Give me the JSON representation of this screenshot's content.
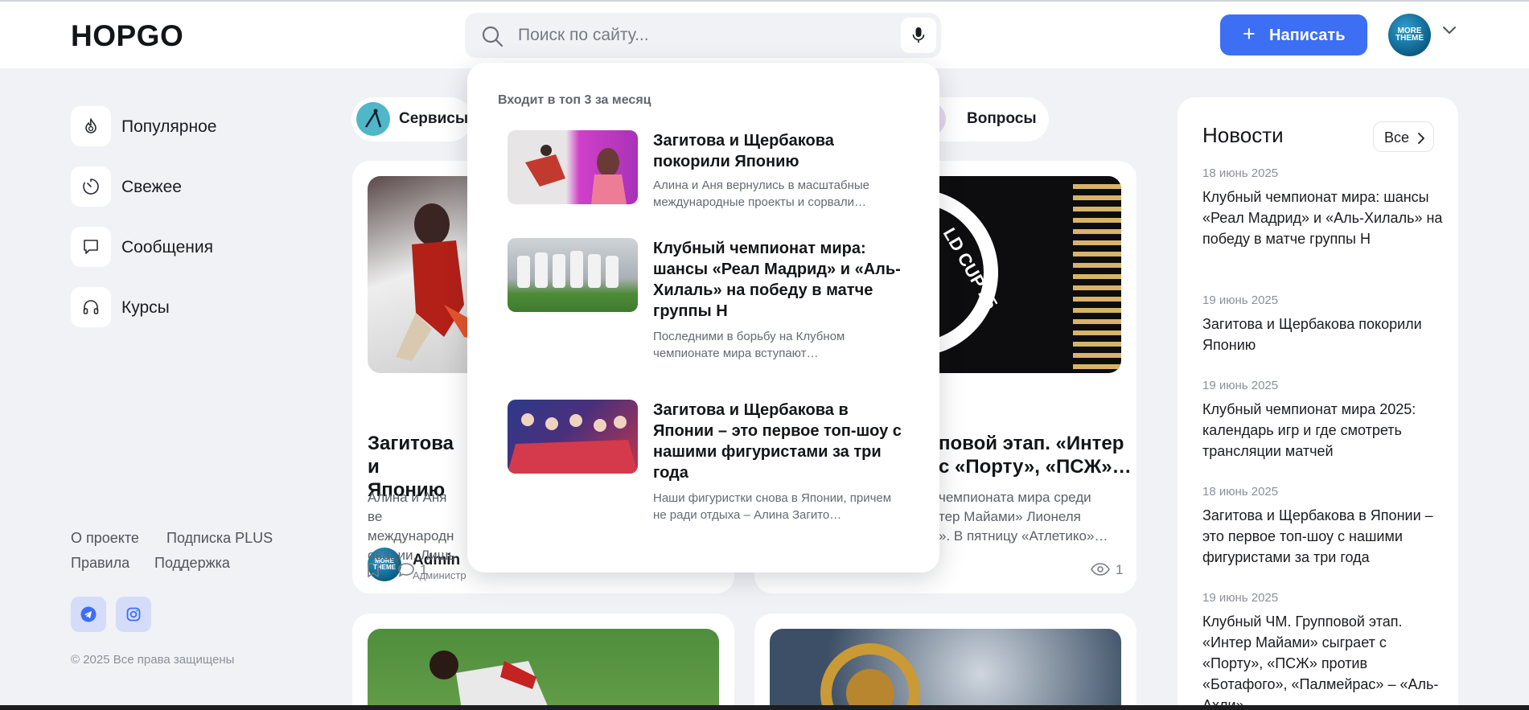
{
  "header": {
    "logo": "HOPGO",
    "search_placeholder": "Поиск по сайту...",
    "write_label": "Написать",
    "write_plus": "+",
    "avatar_text": "MORE THEME"
  },
  "sidebar": {
    "items": [
      {
        "label": "Популярное",
        "icon": "flame-icon"
      },
      {
        "label": "Свежее",
        "icon": "timer-icon"
      },
      {
        "label": "Сообщения",
        "icon": "message-icon"
      },
      {
        "label": "Курсы",
        "icon": "headphones-icon"
      }
    ],
    "footer_links": [
      "О проекте",
      "Подписка PLUS",
      "Правила",
      "Поддержка"
    ],
    "social": [
      "telegram-icon",
      "instagram-icon"
    ],
    "copyright": "© 2025 Все права защищены"
  },
  "chips": [
    {
      "label": "Сервисы"
    },
    {
      "label": "Вопросы"
    }
  ],
  "cards": [
    {
      "author": "Admin",
      "role": "Администр",
      "avatar_text": "MORE THEME",
      "title": "Загитова и Щербакова покорили Японию",
      "title_visible": "Загитова и\nЯпонию",
      "excerpt": "Алина и Аня вернулись в масштабные международные проекты и сорвали овации. Лишь",
      "excerpt_visible": "Алина и Аня ве\nмеждународн\nовации. Лишь",
      "comments": "1"
    },
    {
      "title_visible": "повой этап. «Интер\nс «Порту», «ПСЖ»…",
      "excerpt_visible": "чемпионата мира среди\nтер Майами» Лионеля\n». В пятницу «Атлетико»…",
      "views": "1"
    }
  ],
  "dropdown": {
    "heading": "Входит в топ 3 за месяц",
    "items": [
      {
        "title": "Загитова и Щербакова покорили Японию",
        "excerpt": "Алина и Аня вернулись в масштабные международные проекты и сорвали…"
      },
      {
        "title": "Клубный чемпионат мира: шансы «Реал Мадрид» и «Аль-Хилаль» на победу в матче группы H",
        "excerpt": "Последними в борьбу на Клубном чемпионате мира вступают…"
      },
      {
        "title": "Загитова и Щербакова в Японии – это первое топ-шоу с нашими фигуристами за три года",
        "excerpt": "Наши фигуристки снова в Японии, причем не ради отдыха – Алина Загито…"
      }
    ]
  },
  "news": {
    "title": "Новости",
    "all_label": "Все",
    "items": [
      {
        "date": "18 июнь 2025",
        "title": "Клубный чемпионат мира: шансы «Реал Мадрид» и «Аль-Хилаль» на победу в матче группы H"
      },
      {
        "date": "19 июнь 2025",
        "title": "Загитова и Щербакова покорили Японию"
      },
      {
        "date": "19 июнь 2025",
        "title": "Клубный чемпионат мира 2025: календарь игр и где смотреть трансляции матчей"
      },
      {
        "date": "18 июнь 2025",
        "title": "Загитова и Щербакова в Японии – это первое топ-шоу с нашими фигуристами за три года"
      },
      {
        "date": "19 июнь 2025",
        "title": "Клубный ЧМ. Групповой этап. «Интер Майами» сыграет с «Порту», «ПСЖ» против «Ботафого», «Палмейрас» – «Аль-Ахли»"
      }
    ]
  },
  "colors": {
    "accent": "#3d6ff5",
    "background": "#f1f2f6",
    "social_bg": "#d4dcf9"
  }
}
